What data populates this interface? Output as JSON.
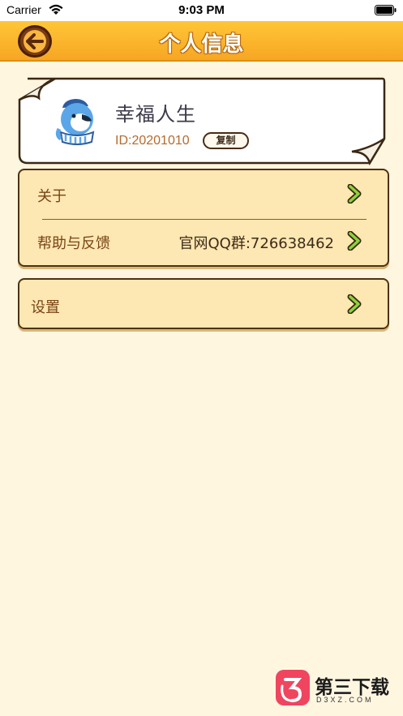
{
  "status_bar": {
    "carrier": "Carrier",
    "time": "9:03 PM"
  },
  "nav": {
    "title": "个人信息",
    "back_icon": "arrow-left-icon"
  },
  "profile": {
    "name": "幸福人生",
    "id_text": "ID:20201010",
    "copy_label": "复制",
    "avatar_icon": "penguin-avatar"
  },
  "menu": {
    "about_label": "关于",
    "help_label": "帮助与反馈",
    "help_value": "官网QQ群:726638462",
    "settings_label": "设置"
  },
  "watermark": {
    "title": "第三下载",
    "subtitle": "D3XZ.COM"
  },
  "colors": {
    "background": "#fff6e0",
    "nav_bar": "#f7a623",
    "panel": "#fde7b2",
    "border": "#4e3213",
    "arrow": "#8bd43a"
  }
}
